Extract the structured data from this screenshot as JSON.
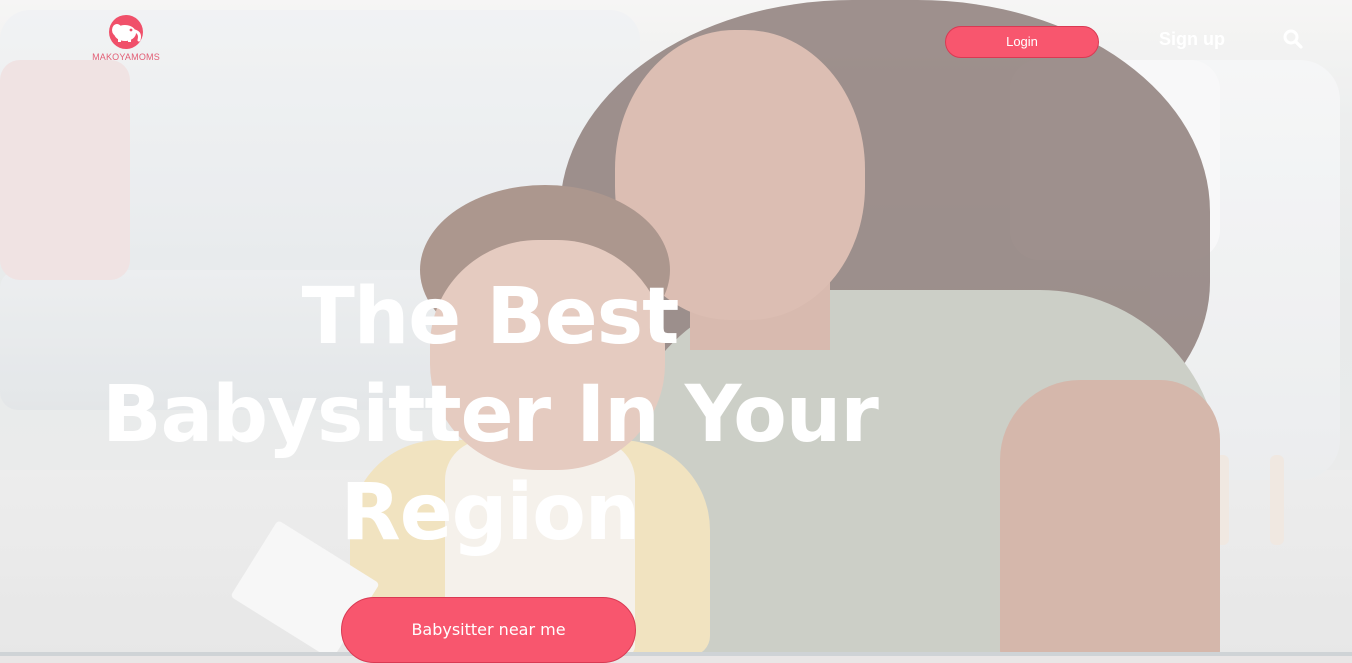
{
  "brand": {
    "name": "MAKOYAMOMS",
    "accent_color": "#f8566e",
    "logo_icon": "elephant-icon"
  },
  "header": {
    "login_label": "Login",
    "signup_label": "Sign up",
    "search_icon": "search-icon"
  },
  "hero": {
    "title_line1": "The Best",
    "title_line2": "Babysitter In Your",
    "title_line3": "Region",
    "cta_label": "Babysitter near me"
  }
}
